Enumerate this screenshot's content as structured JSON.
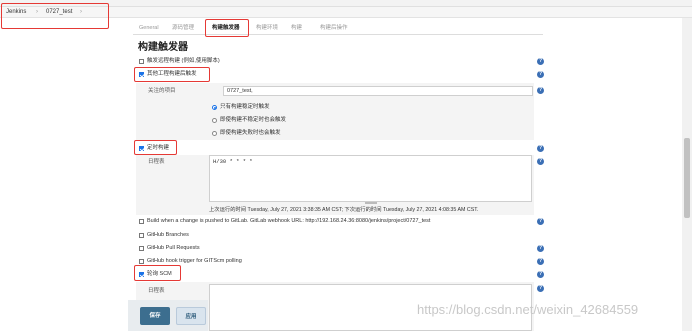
{
  "breadcrumb": {
    "root": "Jenkins",
    "separator": "›",
    "job": "0727_test",
    "trail": "›"
  },
  "tabs": [
    {
      "label": "General"
    },
    {
      "label": "源码管理"
    },
    {
      "label": "构建触发器"
    },
    {
      "label": "构建环境"
    },
    {
      "label": "构建"
    },
    {
      "label": "构建后操作"
    }
  ],
  "page_title": "构建触发器",
  "triggers": {
    "remote": {
      "label": "触发远程构建 (例如,使用脚本)",
      "checked": false
    },
    "upstream": {
      "label": "其他工程构建后触发",
      "checked": true,
      "projects_label": "关注的项目",
      "projects_value": "0727_test,",
      "options": [
        {
          "label": "只有构建稳定时触发",
          "selected": true
        },
        {
          "label": "即使构建不稳定时也会触发",
          "selected": false
        },
        {
          "label": "即使构建失败时也会触发",
          "selected": false
        }
      ]
    },
    "timer": {
      "label": "定时构建",
      "checked": true,
      "schedule_label": "日程表",
      "schedule_value": "H/30 * * * *",
      "run_info": "上次运行的时间 Tuesday, July 27, 2021 3:38:35 AM CST; 下次运行的时间 Tuesday, July 27, 2021 4:08:35 AM CST."
    },
    "gitlab": {
      "label": "Build when a change is pushed to GitLab. GitLab webhook URL: http://192.168.24.36:8080/jenkins/project/0727_test",
      "checked": false
    },
    "github_branches": {
      "label": "GitHub Branches",
      "checked": false
    },
    "github_pr": {
      "label": "GitHub Pull Requests",
      "checked": false
    },
    "github_hook": {
      "label": "GitHub hook trigger for GITScm polling",
      "checked": false
    },
    "scm": {
      "label": "轮询 SCM",
      "checked": true,
      "schedule_label": "日程表"
    }
  },
  "buttons": {
    "save": "保存",
    "apply": "应用"
  },
  "watermark": "https://blog.csdn.net/weixin_42684559",
  "colors": {
    "highlight": "#e53935",
    "save_button": "#3c6e8f",
    "apply_button": "#d9e4ee",
    "help_icon": "#3b6fb5"
  }
}
